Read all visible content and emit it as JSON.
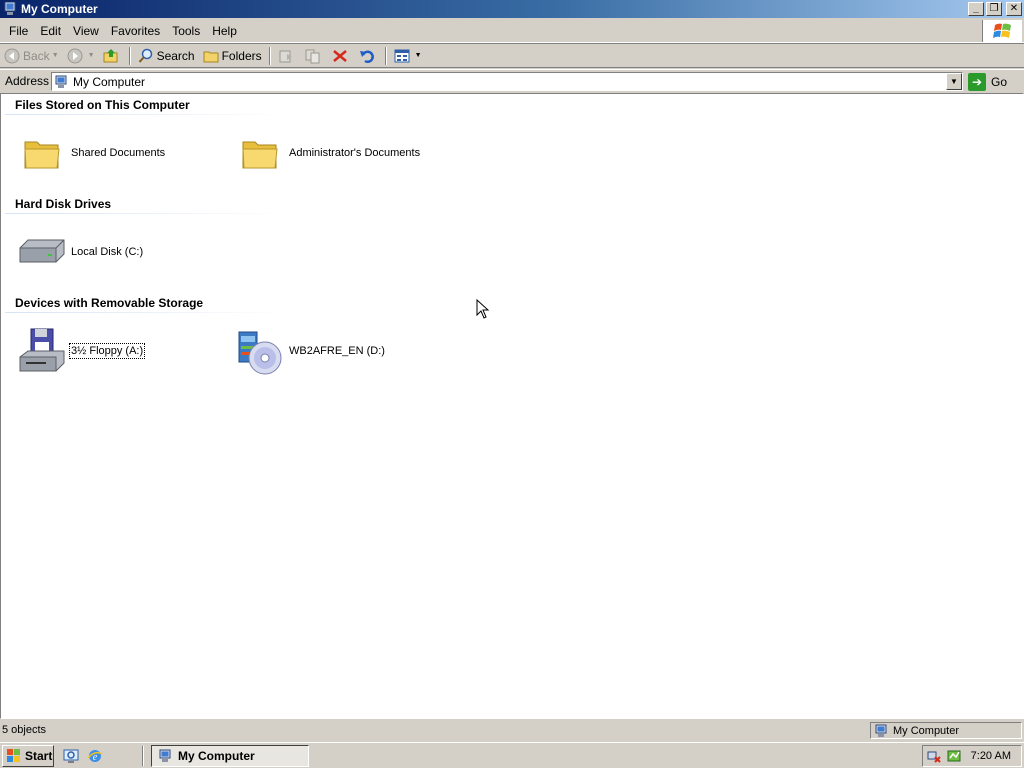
{
  "window": {
    "title": "My Computer",
    "buttons": [
      "_",
      "❐",
      "✕"
    ]
  },
  "menubar": {
    "items": [
      "File",
      "Edit",
      "View",
      "Favorites",
      "Tools",
      "Help"
    ]
  },
  "toolbar": {
    "back": "Back",
    "search": "Search",
    "folders": "Folders"
  },
  "addressbar": {
    "label": "Address",
    "value": "My Computer",
    "go": "Go"
  },
  "groups": [
    {
      "title": "Files Stored on This Computer",
      "items": [
        "Shared Documents",
        "Administrator's Documents"
      ]
    },
    {
      "title": "Hard Disk Drives",
      "items": [
        "Local Disk (C:)"
      ]
    },
    {
      "title": "Devices with Removable Storage",
      "items": [
        "3½ Floppy (A:)",
        "WB2AFRE_EN (D:)"
      ]
    }
  ],
  "statusbar": {
    "left": "5 objects",
    "right": "My Computer"
  },
  "taskbar": {
    "start": "Start",
    "task": "My Computer",
    "clock": "7:20 AM"
  },
  "colors": {
    "titlebar_start": "#0a246a",
    "titlebar_end": "#a6caf0",
    "face": "#d4d0c8",
    "content_bg": "#ffffff"
  }
}
